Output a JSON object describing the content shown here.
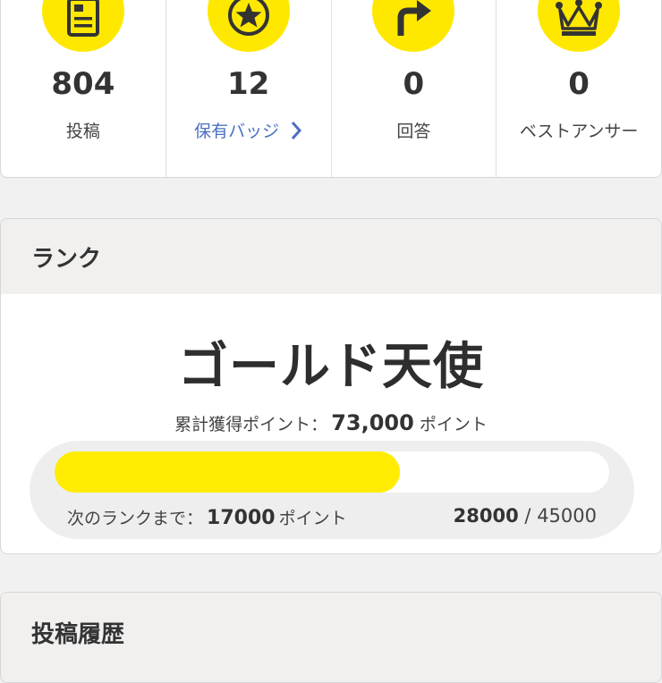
{
  "stats": [
    {
      "icon": "document-icon",
      "value": "804",
      "label": "投稿",
      "link": false
    },
    {
      "icon": "star-badge-icon",
      "value": "12",
      "label": "保有バッジ",
      "link": true
    },
    {
      "icon": "reply-arrow-icon",
      "value": "0",
      "label": "回答",
      "link": false
    },
    {
      "icon": "crown-icon",
      "value": "0",
      "label": "ベストアンサー",
      "link": false
    }
  ],
  "rank": {
    "header": "ランク",
    "name": "ゴールド天使",
    "total_label": "累計獲得ポイント：",
    "total_value": "73,000",
    "point_unit": "ポイント",
    "next_label": "次のランクまで：",
    "next_value": "17000",
    "current": "28000",
    "separator": "/",
    "max": "45000",
    "progress_fraction": 0.622
  },
  "history": {
    "header": "投稿履歴"
  },
  "colors": {
    "accent": "#ffe800",
    "link": "#4a6fc2"
  }
}
